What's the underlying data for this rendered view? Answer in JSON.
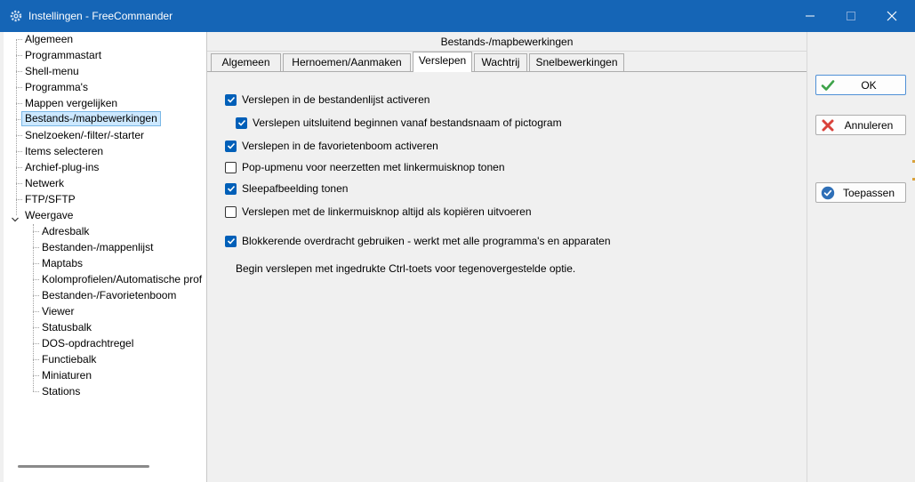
{
  "window": {
    "title": "Instellingen - FreeCommander",
    "icons": {
      "app": "gear-icon",
      "minimize": "minimize-icon",
      "maximize": "maximize-icon",
      "close": "close-icon"
    }
  },
  "tree": {
    "items": [
      {
        "label": "Algemeen"
      },
      {
        "label": "Programmastart"
      },
      {
        "label": "Shell-menu"
      },
      {
        "label": "Programma's"
      },
      {
        "label": "Mappen vergelijken"
      },
      {
        "label": "Bestands-/mapbewerkingen",
        "selected": true
      },
      {
        "label": "Snelzoeken/-filter/-starter"
      },
      {
        "label": "Items selecteren"
      },
      {
        "label": "Archief-plug-ins"
      },
      {
        "label": "Netwerk"
      },
      {
        "label": "FTP/SFTP"
      },
      {
        "label": "Weergave",
        "expanded": true
      },
      {
        "label": "Adresbalk"
      },
      {
        "label": "Bestanden-/mappenlijst"
      },
      {
        "label": "Maptabs"
      },
      {
        "label": "Kolomprofielen/Automatische prof"
      },
      {
        "label": "Bestanden-/Favorietenboom"
      },
      {
        "label": "Viewer"
      },
      {
        "label": "Statusbalk"
      },
      {
        "label": "DOS-opdrachtregel"
      },
      {
        "label": "Functiebalk"
      },
      {
        "label": "Miniaturen"
      },
      {
        "label": "Stations"
      }
    ]
  },
  "panel": {
    "header": "Bestands-/mapbewerkingen",
    "tabs": [
      {
        "label": "Algemeen"
      },
      {
        "label": "Hernoemen/Aanmaken"
      },
      {
        "label": "Verslepen",
        "active": true
      },
      {
        "label": "Wachtrij"
      },
      {
        "label": "Snelbewerkingen"
      }
    ],
    "options": [
      {
        "label": "Verslepen in de bestandenlijst activeren",
        "checked": true
      },
      {
        "label": "Verslepen uitsluitend beginnen vanaf bestandsnaam of pictogram",
        "checked": true
      },
      {
        "label": "Verslepen in de favorietenboom activeren",
        "checked": true
      },
      {
        "label": "Pop-upmenu voor neerzetten met linkermuisknop tonen",
        "checked": false
      },
      {
        "label": "Sleepafbeelding tonen",
        "checked": true
      },
      {
        "label": "Verslepen met de linkermuisknop altijd als kopiëren uitvoeren",
        "checked": false
      },
      {
        "label": "Blokkerende overdracht gebruiken - werkt met alle programma's en apparaten",
        "checked": true
      }
    ],
    "hint": "Begin verslepen met ingedrukte Ctrl-toets voor tegenovergestelde optie."
  },
  "buttons": {
    "ok": {
      "label": "OK",
      "icon": "checkmark-icon",
      "color": "#3ea34a"
    },
    "cancel": {
      "label": "Annuleren",
      "icon": "x-icon",
      "color": "#d9413a"
    },
    "apply": {
      "label": "Toepassen",
      "icon": "check-circle-icon",
      "color": "#2e6fb7"
    }
  },
  "colors": {
    "titlebar": "#1565b6",
    "checkbox": "#005fb8",
    "selection": "#cce8ff"
  }
}
